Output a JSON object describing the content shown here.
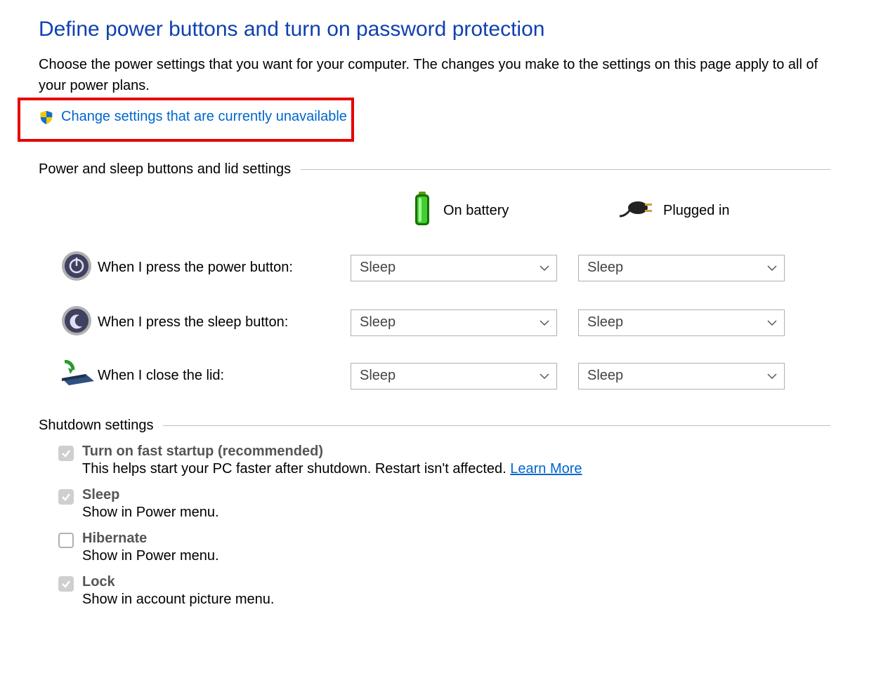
{
  "title": "Define power buttons and turn on password protection",
  "intro": "Choose the power settings that you want for your computer. The changes you make to the settings on this page apply to all of your power plans.",
  "admin_link": "Change settings that are currently unavailable",
  "section1": "Power and sleep buttons and lid settings",
  "columns": {
    "battery": "On battery",
    "plugged": "Plugged in"
  },
  "rows": {
    "power_button": {
      "label": "When I press the power button:",
      "battery": "Sleep",
      "plugged": "Sleep"
    },
    "sleep_button": {
      "label": "When I press the sleep button:",
      "battery": "Sleep",
      "plugged": "Sleep"
    },
    "close_lid": {
      "label": "When I close the lid:",
      "battery": "Sleep",
      "plugged": "Sleep"
    }
  },
  "section2": "Shutdown settings",
  "shutdown": {
    "fast_startup": {
      "title": "Turn on fast startup (recommended)",
      "desc_prefix": "This helps start your PC faster after shutdown. Restart isn't affected. ",
      "learn_more": "Learn More",
      "checked": true
    },
    "sleep": {
      "title": "Sleep",
      "desc": "Show in Power menu.",
      "checked": true
    },
    "hibernate": {
      "title": "Hibernate",
      "desc": "Show in Power menu.",
      "checked": false
    },
    "lock": {
      "title": "Lock",
      "desc": "Show in account picture menu.",
      "checked": true
    }
  }
}
